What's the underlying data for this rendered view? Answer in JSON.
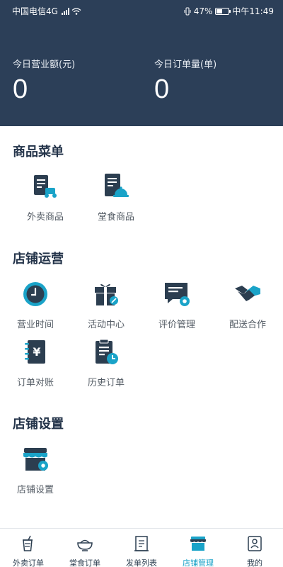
{
  "status_bar": {
    "carrier": "中国电信4G",
    "network_tag": "4G",
    "battery": "47%",
    "battery_level": 0.47,
    "time": "中午11:49"
  },
  "stats": [
    {
      "label": "今日营业额(元)",
      "value": "0"
    },
    {
      "label": "今日订单量(单)",
      "value": "0"
    }
  ],
  "sections": {
    "products": {
      "title": "商品菜单",
      "items": [
        {
          "label": "外卖商品",
          "icon": "delivery-product-icon"
        },
        {
          "label": "堂食商品",
          "icon": "dine-in-product-icon"
        }
      ]
    },
    "operations": {
      "title": "店铺运营",
      "items": [
        {
          "label": "营业时间",
          "icon": "clock-icon"
        },
        {
          "label": "活动中心",
          "icon": "gift-icon"
        },
        {
          "label": "评价管理",
          "icon": "review-icon"
        },
        {
          "label": "配送合作",
          "icon": "handshake-icon"
        },
        {
          "label": "订单对账",
          "icon": "yuan-ledger-icon"
        },
        {
          "label": "历史订单",
          "icon": "history-order-icon"
        }
      ]
    },
    "settings": {
      "title": "店铺设置",
      "items": [
        {
          "label": "店铺设置",
          "icon": "store-settings-icon"
        }
      ]
    }
  },
  "tabbar": {
    "active": 3,
    "items": [
      {
        "label": "外卖订单",
        "icon": "takeaway-cup-icon"
      },
      {
        "label": "堂食订单",
        "icon": "dine-bowl-icon"
      },
      {
        "label": "发单列表",
        "icon": "dispatch-list-icon"
      },
      {
        "label": "店铺管理",
        "icon": "store-icon"
      },
      {
        "label": "我的",
        "icon": "profile-icon"
      }
    ]
  },
  "colors": {
    "header_bg": "#2c3f58",
    "accent": "#1aa3c8",
    "icon_dark": "#2c3e50"
  }
}
